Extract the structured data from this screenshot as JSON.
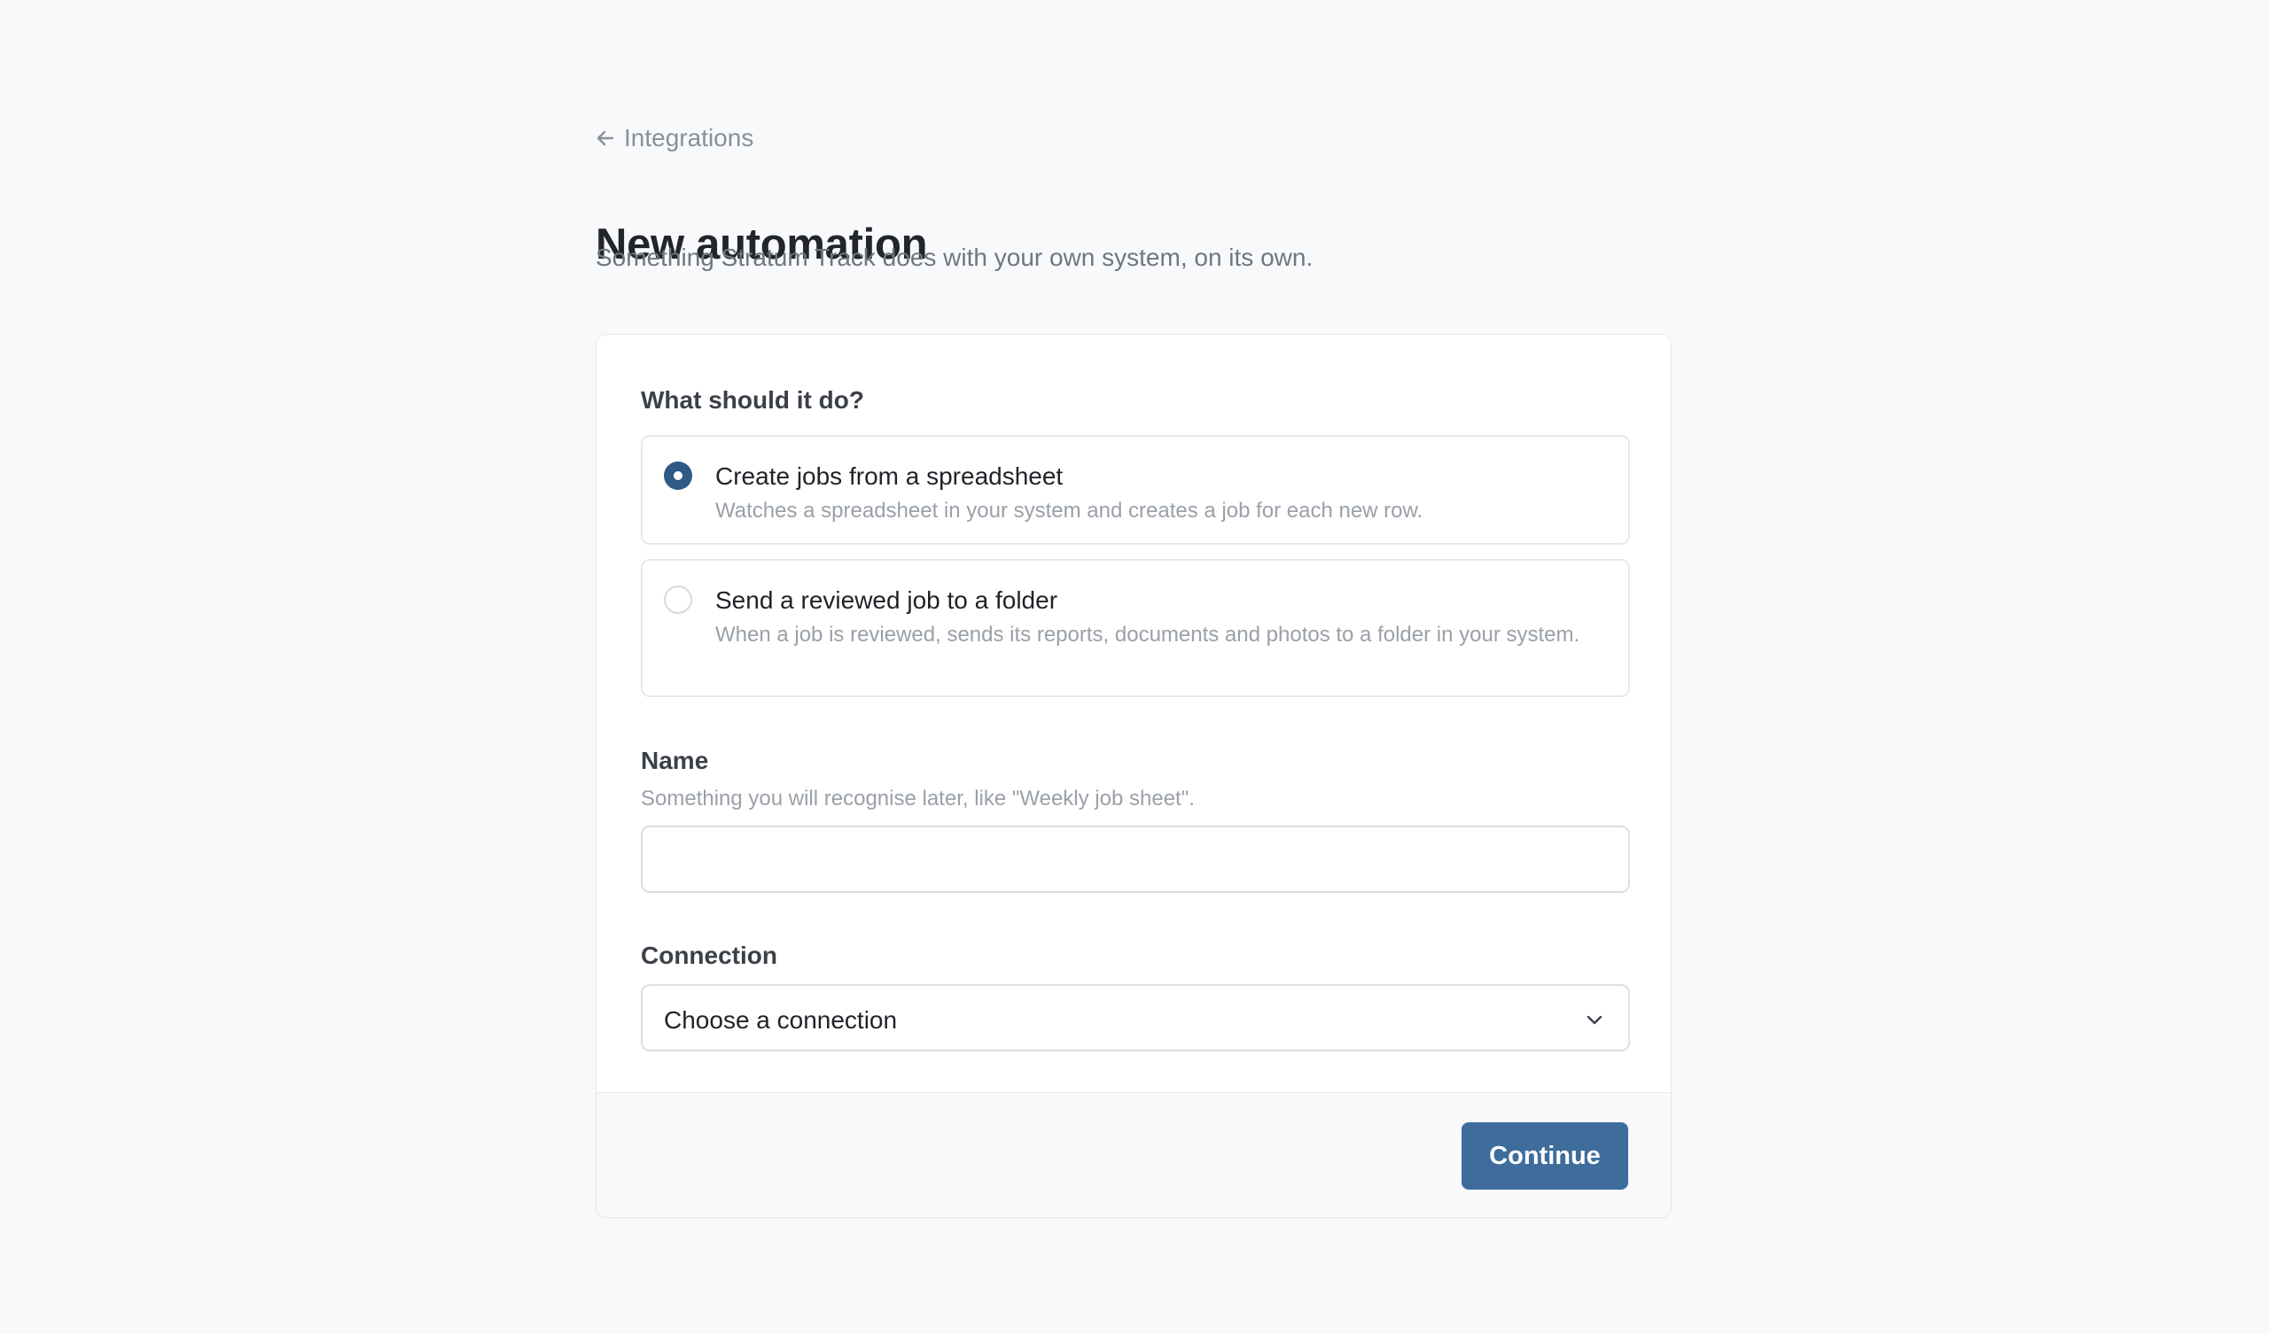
{
  "header": {
    "back_label": "Integrations",
    "title": "New automation",
    "subtitle": "Something Stratum Track does with your own system, on its own."
  },
  "form": {
    "question_label": "What should it do?",
    "options": [
      {
        "title": "Create jobs from a spreadsheet",
        "description": "Watches a spreadsheet in your system and creates a job for each new row.",
        "selected": true
      },
      {
        "title": "Send a reviewed job to a folder",
        "description": "When a job is reviewed, sends its reports, documents and photos to a folder in your system.",
        "selected": false
      }
    ],
    "name": {
      "label": "Name",
      "help": "Something you will recognise later, like \"Weekly job sheet\".",
      "value": ""
    },
    "connection": {
      "label": "Connection",
      "selected": "Choose a connection"
    },
    "continue_label": "Continue"
  },
  "colors": {
    "accent": "#3e6d9c",
    "radio_checked": "#2f5a85",
    "background": "#f8f9fb"
  },
  "icons": {
    "back": "arrow-left-icon",
    "select": "chevron-down-icon"
  }
}
